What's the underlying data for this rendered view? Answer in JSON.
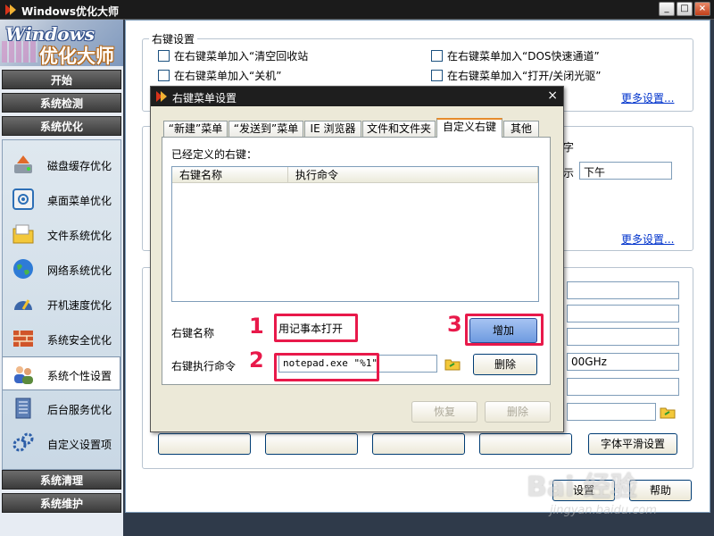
{
  "app": {
    "title": "Windows优化大师",
    "logo_line1": "Windows",
    "logo_line2": "优化大师",
    "win_buttons": {
      "minimize": "_",
      "maximize": "□",
      "close": "×"
    }
  },
  "sidebar": {
    "sections": {
      "start": "开始",
      "detect": "系统检测",
      "optimize": "系统优化",
      "clean": "系统清理",
      "maintain": "系统维护"
    },
    "items": [
      {
        "label": "磁盘缓存优化",
        "icon": "disk-cache-icon"
      },
      {
        "label": "桌面菜单优化",
        "icon": "desktop-menu-icon"
      },
      {
        "label": "文件系统优化",
        "icon": "folder-icon"
      },
      {
        "label": "网络系统优化",
        "icon": "globe-icon"
      },
      {
        "label": "开机速度优化",
        "icon": "speedometer-icon"
      },
      {
        "label": "系统安全优化",
        "icon": "firewall-icon"
      },
      {
        "label": "系统个性设置",
        "icon": "users-icon",
        "active": true
      },
      {
        "label": "后台服务优化",
        "icon": "server-icon"
      },
      {
        "label": "自定义设置项",
        "icon": "gears-icon"
      }
    ]
  },
  "main": {
    "group_rightclick_title": "右键设置",
    "checkboxes": [
      "在右键菜单加入“清空回收站",
      "在右键菜单加入“DOS快速通道”",
      "在右键菜单加入“关机”",
      "在右键菜单加入“打开/关闭光驱”"
    ],
    "more_settings_1": "更多设置...",
    "more_settings_2": "更多设置...",
    "partial_label_char": "字",
    "partial_label_show": "示",
    "afternoon_value": "下午",
    "cpu_value": "00GHz",
    "font_smooth_button": "字体平滑设置",
    "bottom_set_button": "设置",
    "bottom_help_button": "帮助"
  },
  "dialog": {
    "title": "右键菜单设置",
    "close": "×",
    "tabs": [
      "“新建”菜单",
      "“发送到”菜单",
      "IE 浏览器",
      "文件和文件夹",
      "自定义右键",
      "其他"
    ],
    "active_tab": "自定义右键",
    "defined_label": "已经定义的右键：",
    "columns": [
      "右键名称",
      "执行命令"
    ],
    "name_label": "右键名称",
    "name_value": "用记事本打开",
    "cmd_label": "右键执行命令",
    "cmd_value": "notepad.exe \"%1\"",
    "add_button": "增加",
    "delete_button": "删除",
    "restore_button": "恢复",
    "delete_button_disabled": "删除",
    "callouts": [
      "1",
      "2",
      "3"
    ]
  },
  "watermark": {
    "line1": "Bai 经验",
    "line2": "jingyan.baidu.com"
  },
  "colors": {
    "callout": "#e8194a",
    "link": "#0033cc",
    "add_button": "#6e9be0"
  }
}
